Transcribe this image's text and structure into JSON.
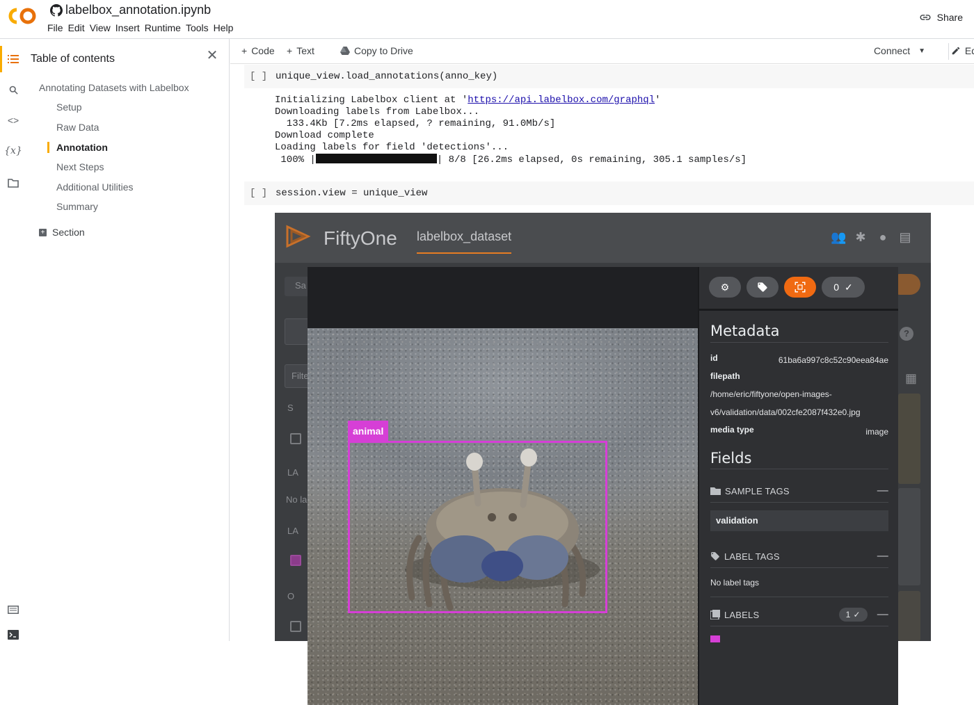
{
  "colab": {
    "title": "labelbox_annotation.ipynb",
    "menus": [
      "File",
      "Edit",
      "View",
      "Insert",
      "Runtime",
      "Tools",
      "Help"
    ],
    "share_label": "Share"
  },
  "toc": {
    "title": "Table of contents",
    "items": [
      {
        "label": "Annotating Datasets with Labelbox",
        "level": 1
      },
      {
        "label": "Setup",
        "level": 2
      },
      {
        "label": "Raw Data",
        "level": 2
      },
      {
        "label": "Annotation",
        "level": 2
      },
      {
        "label": "Next Steps",
        "level": 2
      },
      {
        "label": "Additional Utilities",
        "level": 2
      },
      {
        "label": "Summary",
        "level": 2
      }
    ],
    "section_label": "Section"
  },
  "toolbar": {
    "code_label": "Code",
    "text_label": "Text",
    "copy_label": "Copy to Drive",
    "connect_label": "Connect",
    "edit_label": "Ed"
  },
  "cells": {
    "prompt": "[ ]",
    "cell1_code": "unique_view.load_annotations(anno_key)",
    "out1_prefix": "Initializing Labelbox client at '",
    "out1_link": "https://api.labelbox.com/graphql",
    "out1_suffix": "'",
    "out2": "Downloading labels from Labelbox...",
    "out3": "  133.4Kb [7.2ms elapsed, ? remaining, 91.0Mb/s]",
    "out4": "Download complete",
    "out5": "Loading labels for field 'detections'...",
    "out6_prefix": " 100% |",
    "out6_suffix": "| 8/8 [26.2ms elapsed, 0s remaining, 305.1 samples/s]",
    "cell2_code": "session.view = unique_view"
  },
  "fiftyone": {
    "app_name": "FiftyOne",
    "dataset_name": "labelbox_dataset",
    "bg_fragments": {
      "sample": "Sa",
      "filter": "Filte",
      "no_label": "No la",
      "la1": "LA",
      "la2": "LA",
      "o": "O",
      "s": "S",
      "help": "?"
    },
    "toggle_count": "0",
    "metadata_title": "Metadata",
    "metadata": {
      "id_key": "id",
      "id_value": "61ba6a997c8c52c90eea84ae",
      "filepath_key": "filepath",
      "filepath_value": "/home/eric/fiftyone/open-images-v6/validation/data/002cfe2087f432e0.jpg",
      "media_type_key": "media type",
      "media_type_value": "image"
    },
    "fields_title": "Fields",
    "sample_tags_label": "SAMPLE TAGS",
    "sample_tag_value": "validation",
    "label_tags_label": "LABEL TAGS",
    "label_tags_empty": "No label tags",
    "labels_label": "LABELS",
    "labels_count": "1",
    "detection_label": "animal",
    "accent_color": "#f06a12",
    "box_color": "#d63fd6"
  }
}
